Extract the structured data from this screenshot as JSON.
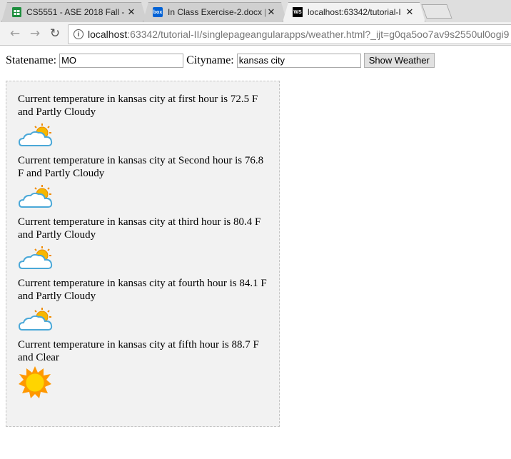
{
  "browser": {
    "tabs": [
      {
        "title": "CS5551 - ASE 2018 Fall -",
        "icon": "google-sheets-icon"
      },
      {
        "title": "In Class Exercise-2.docx |",
        "icon": "box-icon"
      },
      {
        "title": "localhost:63342/tutorial-I",
        "icon": "webstorm-icon"
      }
    ],
    "favicon_text": {
      "box": "box",
      "webstorm": "WS"
    },
    "close_glyph": "✕",
    "address": {
      "host": "localhost",
      "path": ":63342/tutorial-II/singlepageangularapps/weather.html?_ijt=g0qa5oo7av9s2550ul0ogi9"
    },
    "nav_glyphs": {
      "back": "←",
      "forward": "→",
      "reload": "↻"
    },
    "info_glyph": "i"
  },
  "form": {
    "state_label": "Statename:",
    "state_value": "MO",
    "city_label": "Cityname:",
    "city_value": "kansas city",
    "button_label": "Show Weather"
  },
  "weather": [
    {
      "text": "Current temperature in kansas city at first hour is 72.5 F and Partly Cloudy",
      "icon": "partly-cloudy-icon"
    },
    {
      "text": "Current temperature in kansas city at Second hour is 76.8 F and Partly Cloudy",
      "icon": "partly-cloudy-icon"
    },
    {
      "text": "Current temperature in kansas city at third hour is 80.4 F and Partly Cloudy",
      "icon": "partly-cloudy-icon"
    },
    {
      "text": "Current temperature in kansas city at fourth hour is 84.1 F and Partly Cloudy",
      "icon": "partly-cloudy-icon"
    },
    {
      "text": "Current temperature in kansas city at fifth hour is 88.7 F and Clear",
      "icon": "sunny-icon"
    }
  ],
  "colors": {
    "sheets": "#1e8e3e",
    "box": "#0061d5",
    "webstorm": "#000000",
    "sun": "#f6b700",
    "cloud_stroke": "#4aa8d8"
  }
}
